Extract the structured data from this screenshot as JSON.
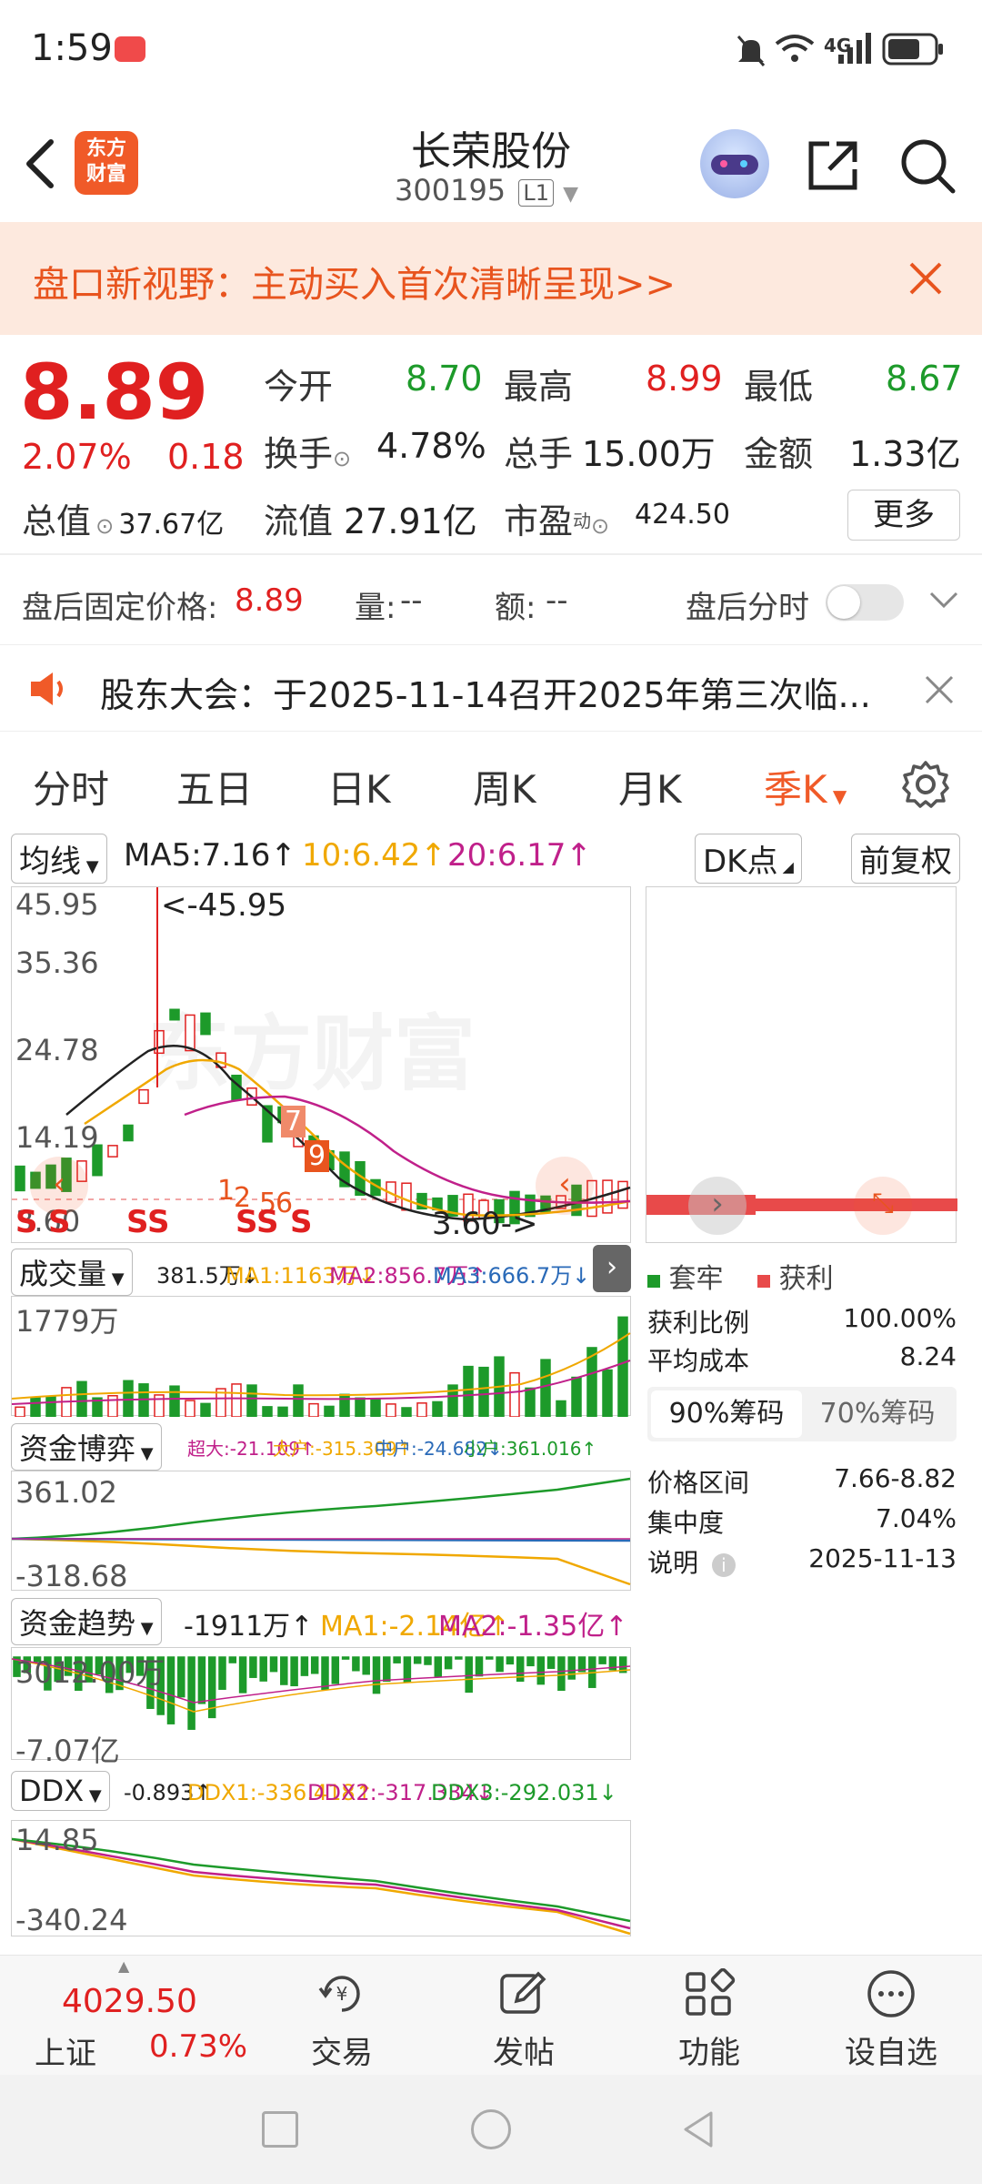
{
  "status_bar": {
    "time": "1:59",
    "network": "4G"
  },
  "header": {
    "app_logo_line1": "东方",
    "app_logo_line2": "财富",
    "stock_name": "长荣股份",
    "stock_code": "300195",
    "level_badge": "L1"
  },
  "banner": {
    "text": "盘口新视野：主动买入首次清晰呈现>>"
  },
  "quote": {
    "price": "8.89",
    "change_pct": "2.07%",
    "change_abs": "0.18",
    "open_label": "今开",
    "open": "8.70",
    "high_label": "最高",
    "high": "8.99",
    "low_label": "最低",
    "low": "8.67",
    "turnover_label": "换手",
    "turnover": "4.78%",
    "volume_label": "总手",
    "volume": "15.00万",
    "amount_label": "金额",
    "amount": "1.33亿",
    "mcap_label": "总值",
    "mcap": "37.67亿",
    "float_label": "流值",
    "float_cap": "27.91亿",
    "pe_label": "市盈",
    "pe_sup": "动",
    "pe": "424.50",
    "more_button": "更多"
  },
  "after_hours": {
    "price_label": "盘后固定价格:",
    "price": "8.89",
    "vol_label": "量:",
    "vol": "--",
    "amt_label": "额:",
    "amt": "--",
    "toggle_label": "盘后分时"
  },
  "notice": {
    "text": "股东大会：于2025-11-14召开2025年第三次临..."
  },
  "chart_tabs": [
    "分时",
    "五日",
    "日K",
    "周K",
    "月K",
    "季K"
  ],
  "active_tab": "季K",
  "kline_header": {
    "mode": "均线",
    "ma5": "MA5:7.16↑",
    "ma10": "10:6.42↑",
    "ma20": "20:6.17↑",
    "dk_button": "DK点",
    "adjust_button": "前复权"
  },
  "kline_panel": {
    "y_labels": [
      "45.95",
      "35.36",
      "24.78",
      "14.19",
      "3.60"
    ],
    "high_annotation": "<-45.95",
    "low_annotation": "3.60->",
    "signals": [
      "S",
      "S",
      "SS",
      "1",
      "2",
      "5",
      "6",
      "SS",
      "S",
      "7",
      "9"
    ],
    "watermark": "东方财富"
  },
  "volume_panel": {
    "title": "成交量",
    "header": "381.5万↓",
    "ma1": "MA1:1163万↓",
    "ma2": "MA2:856.7万↑",
    "ma3": "MA3:666.7万↓",
    "y_label": "1779万"
  },
  "fund_game_panel": {
    "title": "资金博弈",
    "super": "超大:-21.109↑",
    "big": "大户:-315.309↑",
    "mid": "中户:-24.682↓",
    "small": "小户:361.016↑",
    "y_top": "361.02",
    "y_bottom": "-318.68"
  },
  "fund_trend_panel": {
    "title": "资金趋势",
    "value": "-1911万↑",
    "ma1": "MA1:-2.14亿↑",
    "ma2": "MA2:-1.35亿↑",
    "y_top": "3012.00万",
    "y_bottom": "-7.07亿"
  },
  "ddx_panel": {
    "title": "DDX",
    "value": "-0.893↑",
    "ddx1": "DDX1:-336.418↑",
    "ddx2": "DDX2:-317.334↓",
    "ddx3": "DDX3:-292.031↓",
    "y_top": "14.85",
    "y_bottom": "-340.24"
  },
  "chip_panel": {
    "legend_trapped": "套牢",
    "legend_profit": "获利",
    "profit_ratio_label": "获利比例",
    "profit_ratio": "100.00%",
    "avg_cost_label": "平均成本",
    "avg_cost": "8.24",
    "tab_90": "90%筹码",
    "tab_70": "70%筹码",
    "price_range_label": "价格区间",
    "price_range": "7.66-8.82",
    "concentration_label": "集中度",
    "concentration": "7.04%",
    "note_label": "说明",
    "note_date": "2025-11-13"
  },
  "bottom_nav": {
    "index_value": "4029.50",
    "index_name": "上证",
    "index_change": "0.73%",
    "trade": "交易",
    "post": "发帖",
    "functions": "功能",
    "watchlist": "设自选"
  },
  "colors": {
    "up": "#e02020",
    "down": "#1d9a2a",
    "accent": "#f05a28",
    "ma5": "#222222",
    "ma10": "#f0a800",
    "ma20": "#c0208a"
  }
}
